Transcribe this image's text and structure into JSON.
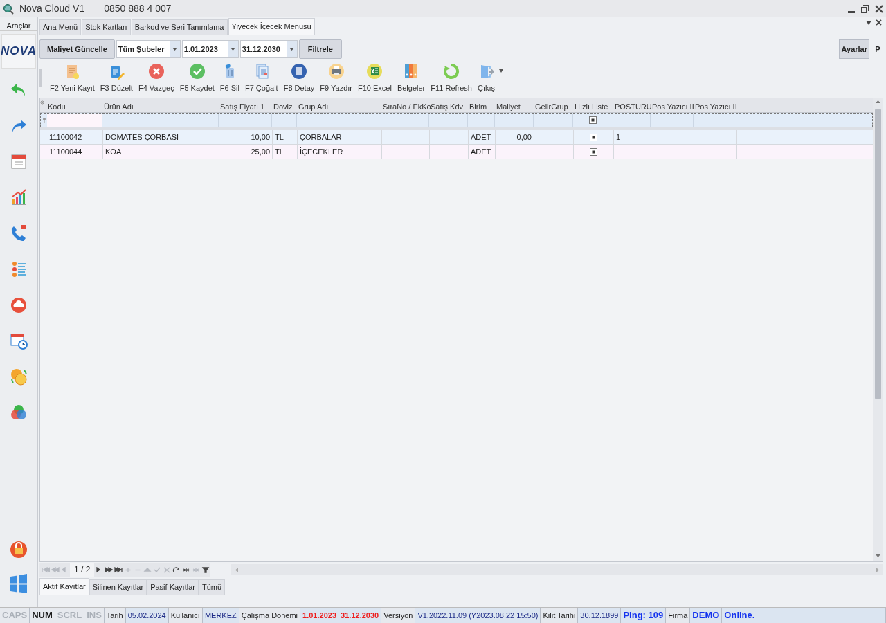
{
  "window": {
    "title": "Nova Cloud V1",
    "phone": "0850 888 4 007"
  },
  "sidebar": {
    "title": "Araçlar",
    "logo": "NOVA"
  },
  "tabs": [
    {
      "label": "Ana Menü",
      "selected": false
    },
    {
      "label": "Stok Kartları",
      "selected": false
    },
    {
      "label": "Barkod ve Seri Tanımlama",
      "selected": false
    },
    {
      "label": "Yiyecek İçecek Menüsü",
      "selected": true
    }
  ],
  "filter_bar": {
    "update_button": "Maliyet Güncelle",
    "branch": "Tüm Şubeler",
    "start_date": "1.01.2023",
    "end_date": "31.12.2030",
    "filter_button": "Filtrele",
    "settings_button": "Ayarlar",
    "p_button": "P"
  },
  "toolbar": [
    {
      "label": "F2 Yeni Kayıt"
    },
    {
      "label": "F3 Düzelt"
    },
    {
      "label": "F4 Vazgeç"
    },
    {
      "label": "F5 Kaydet"
    },
    {
      "label": "F6 Sil"
    },
    {
      "label": "F7 Çoğalt"
    },
    {
      "label": "F8 Detay"
    },
    {
      "label": "F9 Yazdır"
    },
    {
      "label": "F10 Excel"
    },
    {
      "label": "Belgeler"
    },
    {
      "label": "F11 Refresh"
    },
    {
      "label": "Çıkış"
    }
  ],
  "table": {
    "columns": [
      "Kodu",
      "Ürün Adı",
      "Satış Fiyatı 1",
      "Doviz",
      "Grup Adı",
      "SıraNo / EkKo",
      "Satış Kdv",
      "Birim",
      "Maliyet",
      "GelirGrup",
      "Hızlı Liste",
      "POSTURU",
      "Pos Yazıcı II",
      "Pos Yazıcı II"
    ],
    "filter_row": {
      "quick_list_indeterminate": true
    },
    "rows": [
      {
        "code": "11100042",
        "name": "DOMATES ÇORBASI",
        "price": "10,00",
        "currency": "TL",
        "group": "ÇORBALAR",
        "unit": "ADET",
        "cost": "0,00",
        "quick_list_indeterminate": true,
        "posturu": "1"
      },
      {
        "code": "11100044",
        "name": "KOA",
        "price": "25,00",
        "currency": "TL",
        "group": "İÇECEKLER",
        "unit": "ADET",
        "quick_list_indeterminate": true
      }
    ]
  },
  "navigator": {
    "page": "1 / 2"
  },
  "record_tabs": [
    {
      "label": "Aktif Kayıtlar",
      "selected": true
    },
    {
      "label": "Silinen Kayıtlar",
      "selected": false
    },
    {
      "label": "Pasif Kayıtlar",
      "selected": false
    },
    {
      "label": "Tümü",
      "selected": false
    }
  ],
  "status_bar": [
    {
      "text": "CAPS",
      "kind": "key",
      "on": false
    },
    {
      "text": "NUM",
      "kind": "key",
      "on": true
    },
    {
      "text": "SCRL",
      "kind": "key",
      "on": false
    },
    {
      "text": "INS",
      "kind": "key",
      "on": false
    },
    {
      "text": "Tarih",
      "kind": "label"
    },
    {
      "text": "05.02.2024",
      "kind": "value"
    },
    {
      "text": "Kullanıcı",
      "kind": "label"
    },
    {
      "text": "MERKEZ",
      "kind": "value"
    },
    {
      "text": "Çalışma Dönemi",
      "kind": "label"
    },
    {
      "text": "1.01.2023  31.12.2030",
      "kind": "alert"
    },
    {
      "text": "Versiyon",
      "kind": "label"
    },
    {
      "text": "V1.2022.11.09 (Y2023.08.22 15:50)",
      "kind": "value"
    },
    {
      "text": "Kilit Tarihi",
      "kind": "label"
    },
    {
      "text": "30.12.1899",
      "kind": "value"
    },
    {
      "text": "Ping: 109",
      "kind": "highlight"
    },
    {
      "text": "Firma",
      "kind": "label"
    },
    {
      "text": "DEMO",
      "kind": "highlight"
    },
    {
      "text": "Online.",
      "kind": "highlight"
    }
  ]
}
